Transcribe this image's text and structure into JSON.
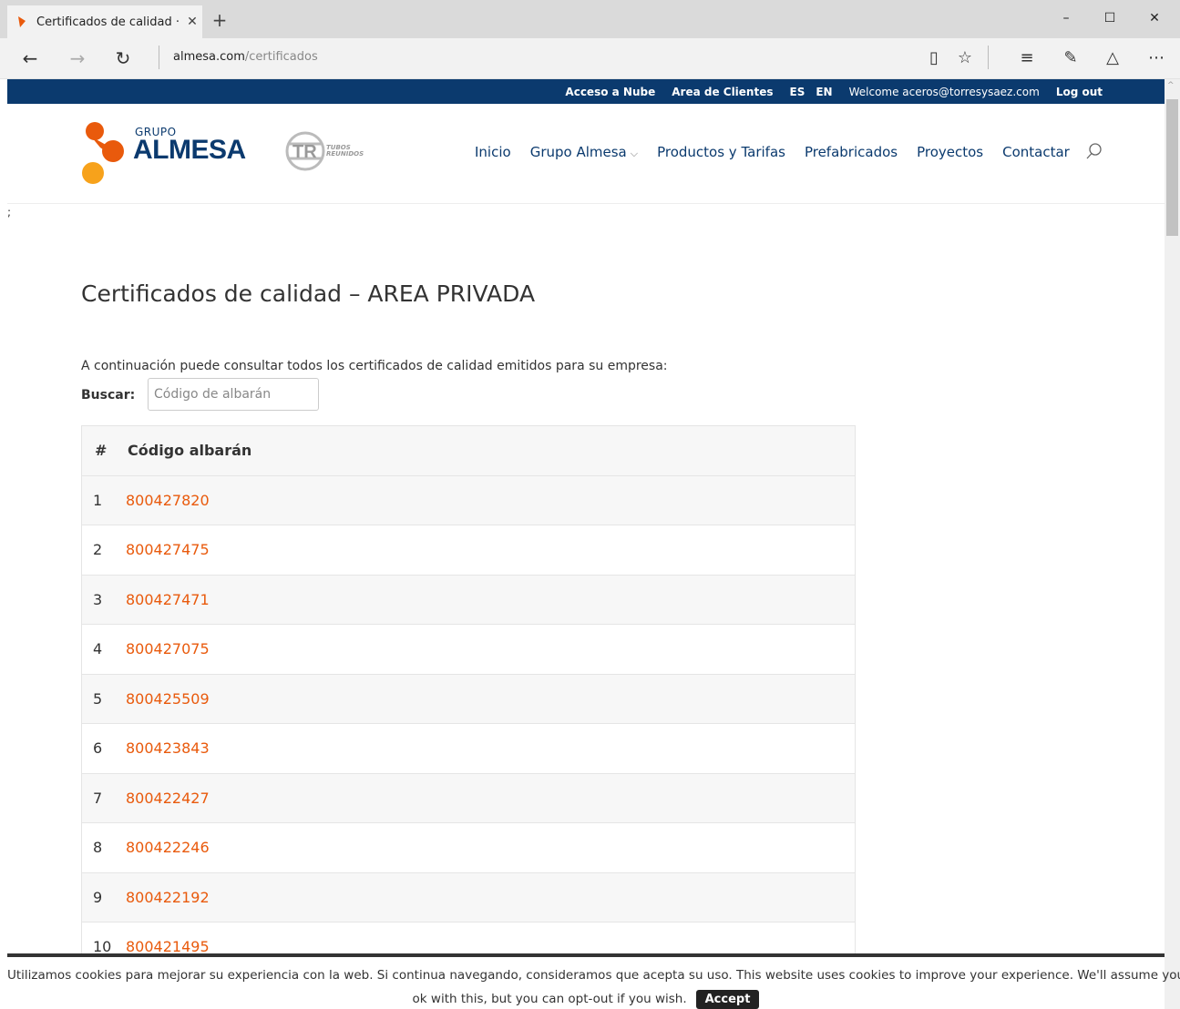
{
  "browser": {
    "tab_title": "Certificados de calidad ·",
    "url_domain": "almesa.com",
    "url_path": "/certificados"
  },
  "topbar": {
    "items": [
      "Acceso a Nube",
      "Area de Clientes"
    ],
    "lang_es": "ES",
    "lang_en": "EN",
    "welcome": "Welcome aceros@torresysaez.com",
    "logout": "Log out"
  },
  "logo": {
    "grupo": "GRUPO",
    "almesa": "ALMESA",
    "tr_line1": "TUBOS",
    "tr_line2": "REUNIDOS"
  },
  "nav": {
    "items": [
      "Inicio",
      "Grupo Almesa",
      "Productos y Tarifas",
      "Prefabricados",
      "Proyectos",
      "Contactar"
    ]
  },
  "stray_text": ";",
  "page": {
    "title": "Certificados de calidad – AREA PRIVADA",
    "intro": "A continuación puede consultar todos los certificados de calidad emitidos para su empresa:",
    "search_label": "Buscar:",
    "search_placeholder": "Código de albarán"
  },
  "table": {
    "headers": [
      "#",
      "Código albarán"
    ],
    "rows": [
      {
        "n": "1",
        "code": "800427820"
      },
      {
        "n": "2",
        "code": "800427475"
      },
      {
        "n": "3",
        "code": "800427471"
      },
      {
        "n": "4",
        "code": "800427075"
      },
      {
        "n": "5",
        "code": "800425509"
      },
      {
        "n": "6",
        "code": "800423843"
      },
      {
        "n": "7",
        "code": "800422427"
      },
      {
        "n": "8",
        "code": "800422246"
      },
      {
        "n": "9",
        "code": "800422192"
      },
      {
        "n": "10",
        "code": "800421495"
      }
    ]
  },
  "cookie": {
    "line1": "Utilizamos cookies para mejorar su experiencia con la web. Si continua navegando, consideramos que acepta su uso. This website uses cookies to improve your experience. We'll assume you're",
    "line2": "ok with this, but you can opt-out if you wish.",
    "accept": "Accept"
  },
  "colors": {
    "brand_blue": "#0b3a6e",
    "link_orange": "#e95a0c"
  }
}
